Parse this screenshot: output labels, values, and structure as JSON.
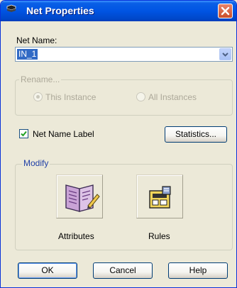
{
  "window": {
    "title": "Net Properties"
  },
  "net_name": {
    "label": "Net Name:",
    "value": "IN_1"
  },
  "rename": {
    "title": "Rename...",
    "this_instance": "This Instance",
    "all_instances": "All Instances",
    "selected": "This Instance"
  },
  "net_name_label": {
    "label": "Net Name Label",
    "checked": true
  },
  "statistics_button": "Statistics...",
  "modify": {
    "title": "Modify",
    "attributes": "Attributes",
    "rules": "Rules"
  },
  "buttons": {
    "ok": "OK",
    "cancel": "Cancel",
    "help": "Help"
  },
  "colors": {
    "titlebar": "#0054e3",
    "close": "#d35a3a",
    "selection": "#316ac5",
    "checkmark": "#21a121"
  }
}
